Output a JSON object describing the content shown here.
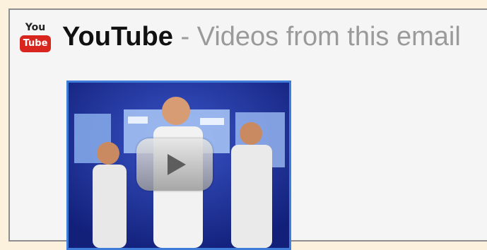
{
  "header": {
    "logo_top": "You",
    "logo_bottom": "Tube",
    "brand": "YouTube",
    "subtitle": " - Videos from this email"
  },
  "video": {
    "icon": "play-icon"
  }
}
